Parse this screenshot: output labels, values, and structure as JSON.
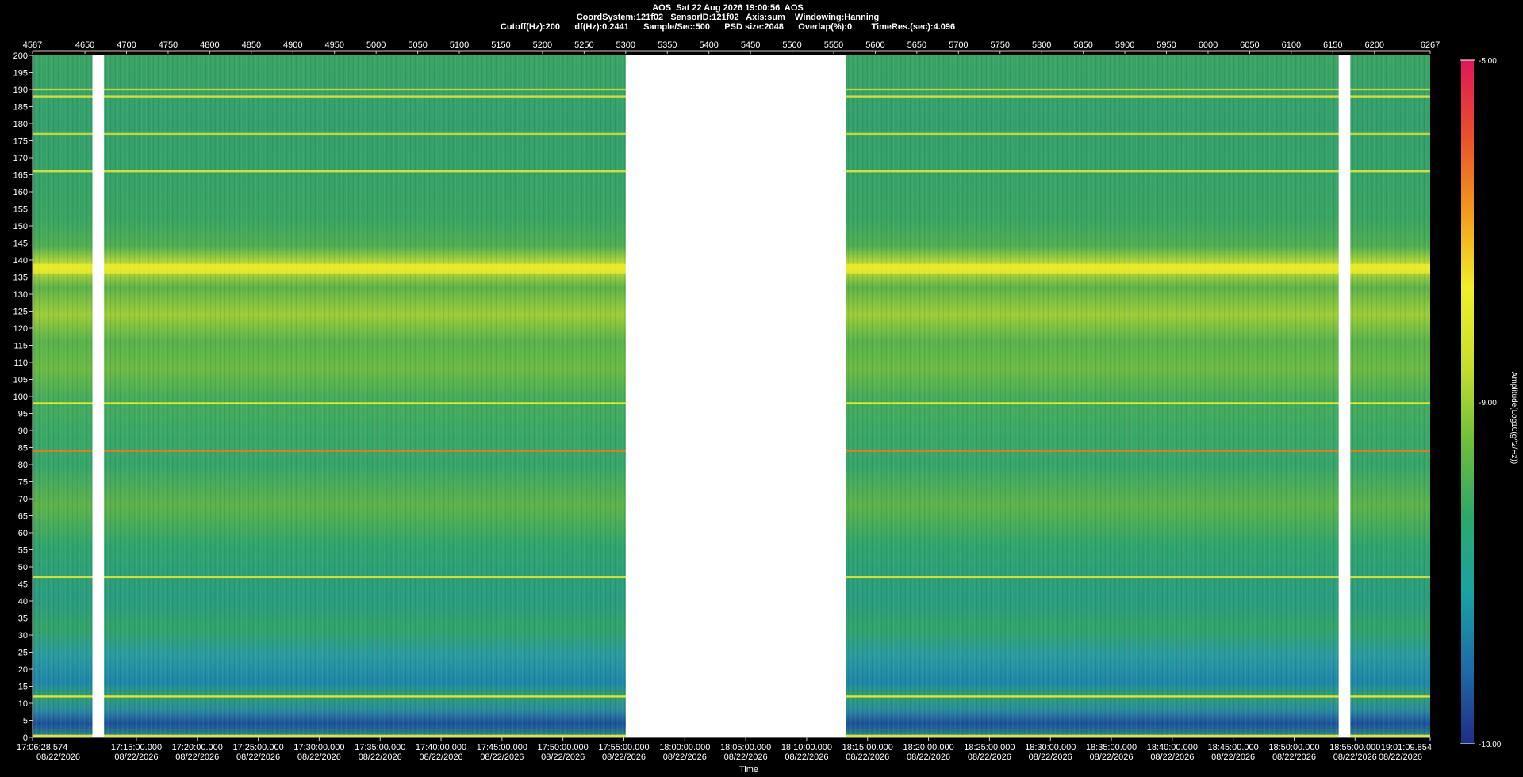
{
  "header": {
    "line1": "AOS  Sat 22 Aug 2026 19:00:56  AOS",
    "line2": "CoordSystem:121f02   SensorID:121f02   Axis:sum    Windowing:Hanning",
    "line3": "Cutoff(Hz):200      df(Hz):0.2441      Sample/Sec:500      PSD size:2048      Overlap(%):0        TimeRes.(sec):4.096"
  },
  "chart_data": {
    "type": "heatmap",
    "top_axis_ticks": [
      "4587",
      "4650",
      "4700",
      "4750",
      "4800",
      "4850",
      "4900",
      "4950",
      "5000",
      "5050",
      "5100",
      "5150",
      "5200",
      "5250",
      "5300",
      "5350",
      "5400",
      "5450",
      "5500",
      "5550",
      "5600",
      "5650",
      "5700",
      "5750",
      "5800",
      "5850",
      "5900",
      "5950",
      "6000",
      "6050",
      "6100",
      "6150",
      "6200",
      "6267"
    ],
    "y_ticks": [
      "200",
      "195",
      "190",
      "185",
      "180",
      "175",
      "170",
      "165",
      "160",
      "155",
      "150",
      "145",
      "140",
      "135",
      "130",
      "125",
      "120",
      "115",
      "110",
      "105",
      "100",
      "95",
      "90",
      "85",
      "80",
      "75",
      "70",
      "65",
      "60",
      "55",
      "50",
      "45",
      "40",
      "35",
      "30",
      "25",
      "20",
      "15",
      "10",
      "5",
      "0"
    ],
    "ylim": [
      0,
      200
    ],
    "xlim_index": [
      4587,
      6267
    ],
    "x_time_labels": [
      {
        "time": "17:06:28.574",
        "date": "08/22/2026"
      },
      {
        "time": "17:15:00.000",
        "date": "08/22/2026"
      },
      {
        "time": "17:20:00.000",
        "date": "08/22/2026"
      },
      {
        "time": "17:25:00.000",
        "date": "08/22/2026"
      },
      {
        "time": "17:30:00.000",
        "date": "08/22/2026"
      },
      {
        "time": "17:35:00.000",
        "date": "08/22/2026"
      },
      {
        "time": "17:40:00.000",
        "date": "08/22/2026"
      },
      {
        "time": "17:45:00.000",
        "date": "08/22/2026"
      },
      {
        "time": "17:50:00.000",
        "date": "08/22/2026"
      },
      {
        "time": "17:55:00.000",
        "date": "08/22/2026"
      },
      {
        "time": "18:00:00.000",
        "date": "08/22/2026"
      },
      {
        "time": "18:05:00.000",
        "date": "08/22/2026"
      },
      {
        "time": "18:10:00.000",
        "date": "08/22/2026"
      },
      {
        "time": "18:15:00.000",
        "date": "08/22/2026"
      },
      {
        "time": "18:20:00.000",
        "date": "08/22/2026"
      },
      {
        "time": "18:25:00.000",
        "date": "08/22/2026"
      },
      {
        "time": "18:30:00.000",
        "date": "08/22/2026"
      },
      {
        "time": "18:35:00.000",
        "date": "08/22/2026"
      },
      {
        "time": "18:40:00.000",
        "date": "08/22/2026"
      },
      {
        "time": "18:45:00.000",
        "date": "08/22/2026"
      },
      {
        "time": "18:50:00.000",
        "date": "08/22/2026"
      },
      {
        "time": "18:55:00.000",
        "date": "08/22/2026"
      },
      {
        "time": "19:01:09.854",
        "date": "08/22/2026"
      }
    ],
    "xlabel": "Time",
    "colorbar": {
      "label": "Amplitude(Log10(g^2/Hz))",
      "max": "-5.00",
      "mid": "-9.00",
      "min": "-13.00",
      "range": [
        -13,
        -5
      ],
      "stops": [
        "#1f2d86",
        "#1f6ca8",
        "#19a3a3",
        "#2ea76a",
        "#6fbf3a",
        "#c8df2e",
        "#f1ef2a",
        "#f29a1e",
        "#e8502b",
        "#e0175a"
      ]
    },
    "data_gaps_index": [
      [
        4659,
        4673
      ],
      [
        5300,
        5565
      ],
      [
        6157,
        6171
      ]
    ],
    "bands_hz": [
      {
        "hz": 0.5,
        "color": "#e8ea3a"
      },
      {
        "hz": 12,
        "color": "#e6e832"
      },
      {
        "hz": 47,
        "color": "#d6e23a"
      },
      {
        "hz": 84,
        "color": "#e07b24"
      },
      {
        "hz": 98,
        "color": "#f1ef2a"
      },
      {
        "hz": 137.5,
        "color": "#f1ef2a"
      },
      {
        "hz": 166,
        "color": "#d8e23a"
      },
      {
        "hz": 177,
        "color": "#c8da3a"
      },
      {
        "hz": 188,
        "color": "#d8e23a"
      },
      {
        "hz": 190,
        "color": "#c8da3a"
      }
    ]
  }
}
